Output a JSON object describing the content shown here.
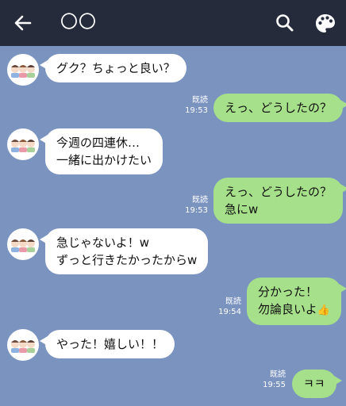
{
  "header": {
    "title": "〇〇",
    "back_icon": "back-arrow-icon",
    "search_icon": "search-icon",
    "theme_icon": "palette-icon",
    "background": "#252b3a"
  },
  "chat": {
    "background": "#7b93bf",
    "incoming_bubble_color": "#ffffff",
    "outgoing_bubble_color": "#a6e08a",
    "messages": [
      {
        "side": "in",
        "lines": [
          "グク？ちょっと良い？"
        ]
      },
      {
        "side": "out",
        "read": "既読",
        "time": "19:53",
        "lines": [
          "えっ、どうしたの？"
        ]
      },
      {
        "side": "in",
        "lines": [
          "今週の四連休…",
          "一緒に出かけたい"
        ]
      },
      {
        "side": "out",
        "read": "既読",
        "time": "19:53",
        "lines": [
          "えっ、どうしたの？",
          "急にw"
        ]
      },
      {
        "side": "in",
        "lines": [
          "急じゃないよ！w",
          "ずっと行きたかったからw"
        ]
      },
      {
        "side": "out",
        "read": "既読",
        "time": "19:54",
        "lines": [
          "分かった！",
          "勿論良いよ"
        ],
        "emoji": "👍"
      },
      {
        "side": "in",
        "lines": [
          "やった！嬉しい！！"
        ]
      },
      {
        "side": "out",
        "read": "既読",
        "time": "19:55",
        "lines": [
          "ㅋㅋ"
        ]
      }
    ]
  }
}
